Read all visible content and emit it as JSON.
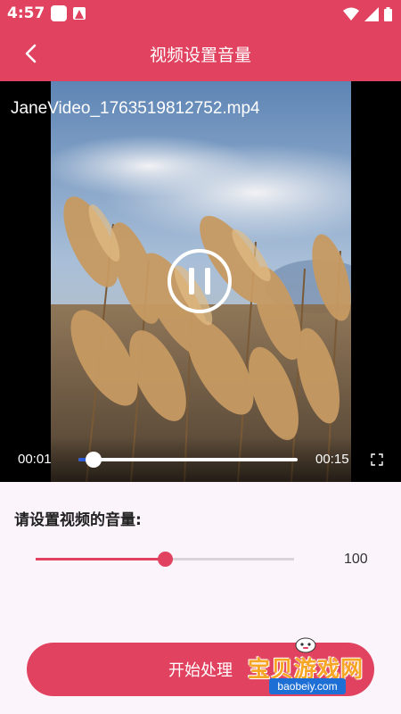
{
  "status_bar": {
    "time": "4:57",
    "icons": [
      "notification-icon",
      "android-auto-icon",
      "wifi-icon",
      "signal-icon",
      "battery-icon"
    ]
  },
  "header": {
    "title": "视频设置音量",
    "back_icon": "chevron-left-icon"
  },
  "video": {
    "filename": "JaneVideo_1763519812752.mp4",
    "state_icon": "pause-icon",
    "current_time": "00:01",
    "duration": "00:15",
    "progress_fraction": 0.07,
    "fullscreen_icon": "fullscreen-icon"
  },
  "volume": {
    "label": "请设置视频的音量:",
    "value": "100",
    "slider_fraction": 0.5
  },
  "actions": {
    "start_label": "开始处理"
  },
  "watermark": {
    "title": "宝贝游戏网",
    "domain": "baobeiy.com"
  },
  "colors": {
    "brand": "#e0425f",
    "seek_played": "#2d5bd6",
    "panel_bg": "#fbf4fb"
  }
}
